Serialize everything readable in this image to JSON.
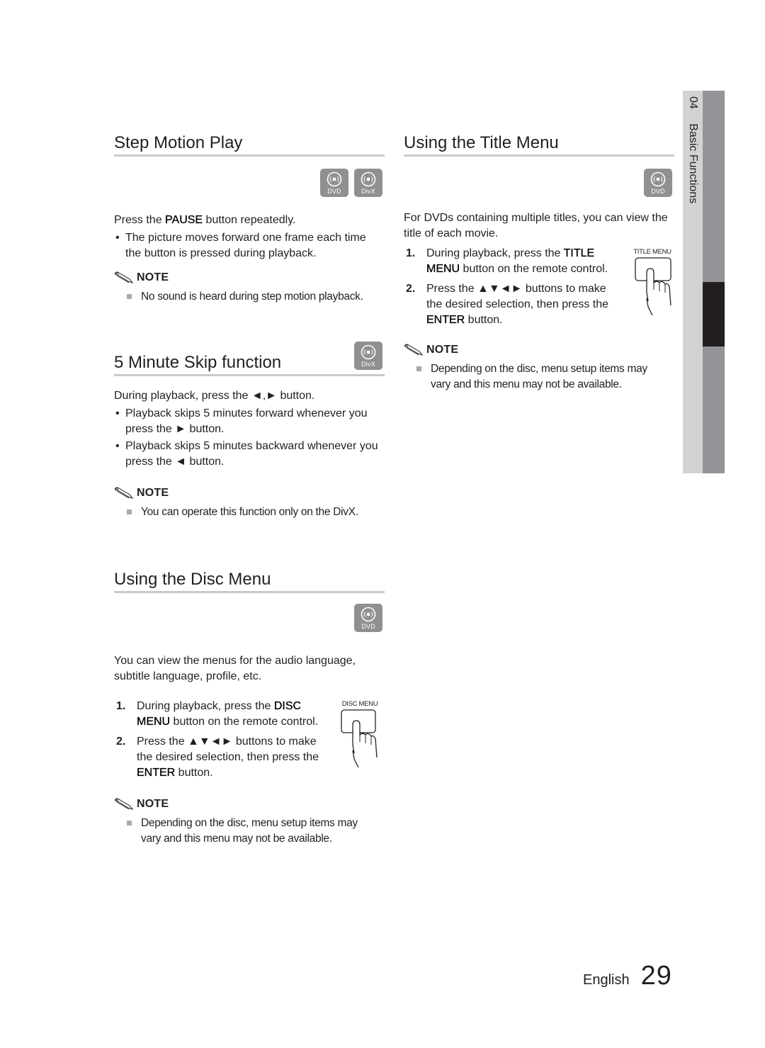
{
  "side_tab": {
    "chapter_number": "04",
    "chapter_title": "Basic Functions"
  },
  "step_motion": {
    "heading": "Step Motion Play",
    "badges": [
      "DVD",
      "DivX"
    ],
    "intro_pre": "Press the ",
    "intro_key": "PAUSE",
    "intro_post": " button repeatedly.",
    "bullets": [
      "The picture moves forward one frame each time the button is pressed during playback."
    ],
    "note_label": "NOTE",
    "notes": [
      "No sound is heard during step motion playback."
    ]
  },
  "minute_skip": {
    "heading": "5 Minute Skip function",
    "badges": [
      "DivX"
    ],
    "intro": "During playback, press the ◄,► button.",
    "bullets": [
      "Playback skips 5 minutes forward whenever you press the ► button.",
      "Playback skips 5 minutes backward whenever you press the ◄ button."
    ],
    "note_label": "NOTE",
    "notes": [
      "You can operate this function only on the DivX."
    ]
  },
  "disc_menu": {
    "heading": "Using the Disc Menu",
    "badges": [
      "DVD"
    ],
    "intro": "You can view the menus for the audio language, subtitle language, profile, etc.",
    "remote_label": "DISC MENU",
    "steps": [
      {
        "num": "1.",
        "pre": "During playback, press the ",
        "key": "DISC MENU",
        "post": " button on the remote control."
      },
      {
        "num": "2.",
        "pre": "Press the ▲▼◄► buttons to make the desired selection, then press the ",
        "key": "ENTER",
        "post": " button."
      }
    ],
    "note_label": "NOTE",
    "notes": [
      "Depending on the disc, menu setup items may vary and this menu may not be available."
    ]
  },
  "title_menu": {
    "heading": "Using the Title Menu",
    "badges": [
      "DVD"
    ],
    "intro": "For DVDs containing multiple titles, you can view the title of each movie.",
    "remote_label": "TITLE MENU",
    "steps": [
      {
        "num": "1.",
        "pre": " During playback, press the ",
        "key": "TITLE MENU",
        "post": " button on the remote control."
      },
      {
        "num": "2.",
        "pre": "Press the ▲▼◄► buttons to make the desired selection, then press the ",
        "key": "ENTER",
        "post": " button."
      }
    ],
    "note_label": "NOTE",
    "notes": [
      "Depending on the disc, menu setup items may vary and this menu may not be available."
    ]
  },
  "footer": {
    "language": "English",
    "page_number": "29"
  },
  "colors": {
    "text": "#231f20",
    "badge_bg": "#8f9092",
    "rule": "#c9cacc",
    "tab_light": "#d1d2d4",
    "tab_mid": "#939598",
    "tab_active": "#231f20"
  }
}
